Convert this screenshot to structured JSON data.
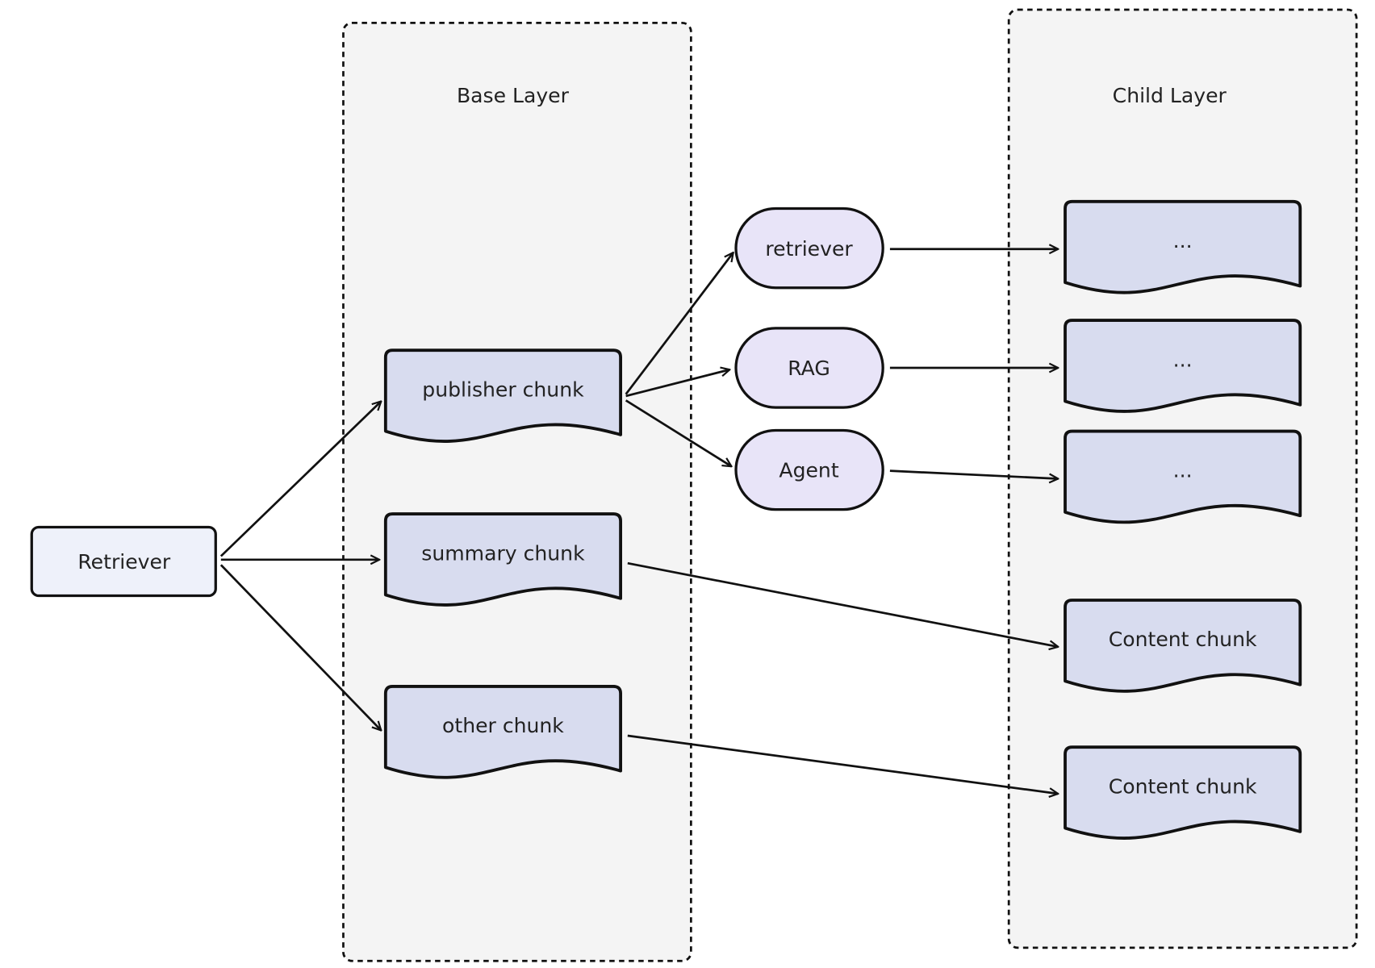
{
  "layers": {
    "base": {
      "title": "Base Layer"
    },
    "child": {
      "title": "Child Layer"
    }
  },
  "nodes": {
    "retriever_root": "Retriever",
    "publisher_chunk": "publisher chunk",
    "summary_chunk": "summary chunk",
    "other_chunk": "other chunk",
    "retriever": "retriever",
    "rag": "RAG",
    "agent": "Agent",
    "child1": "...",
    "child2": "...",
    "child3": "...",
    "content1": "Content chunk",
    "content2": "Content chunk"
  },
  "colors": {
    "layer_bg": "#f4f4f4",
    "chunk_fill": "#d8dcef",
    "pill_fill": "#e8e4f8",
    "root_fill": "#eef1fa",
    "stroke": "#111111"
  }
}
